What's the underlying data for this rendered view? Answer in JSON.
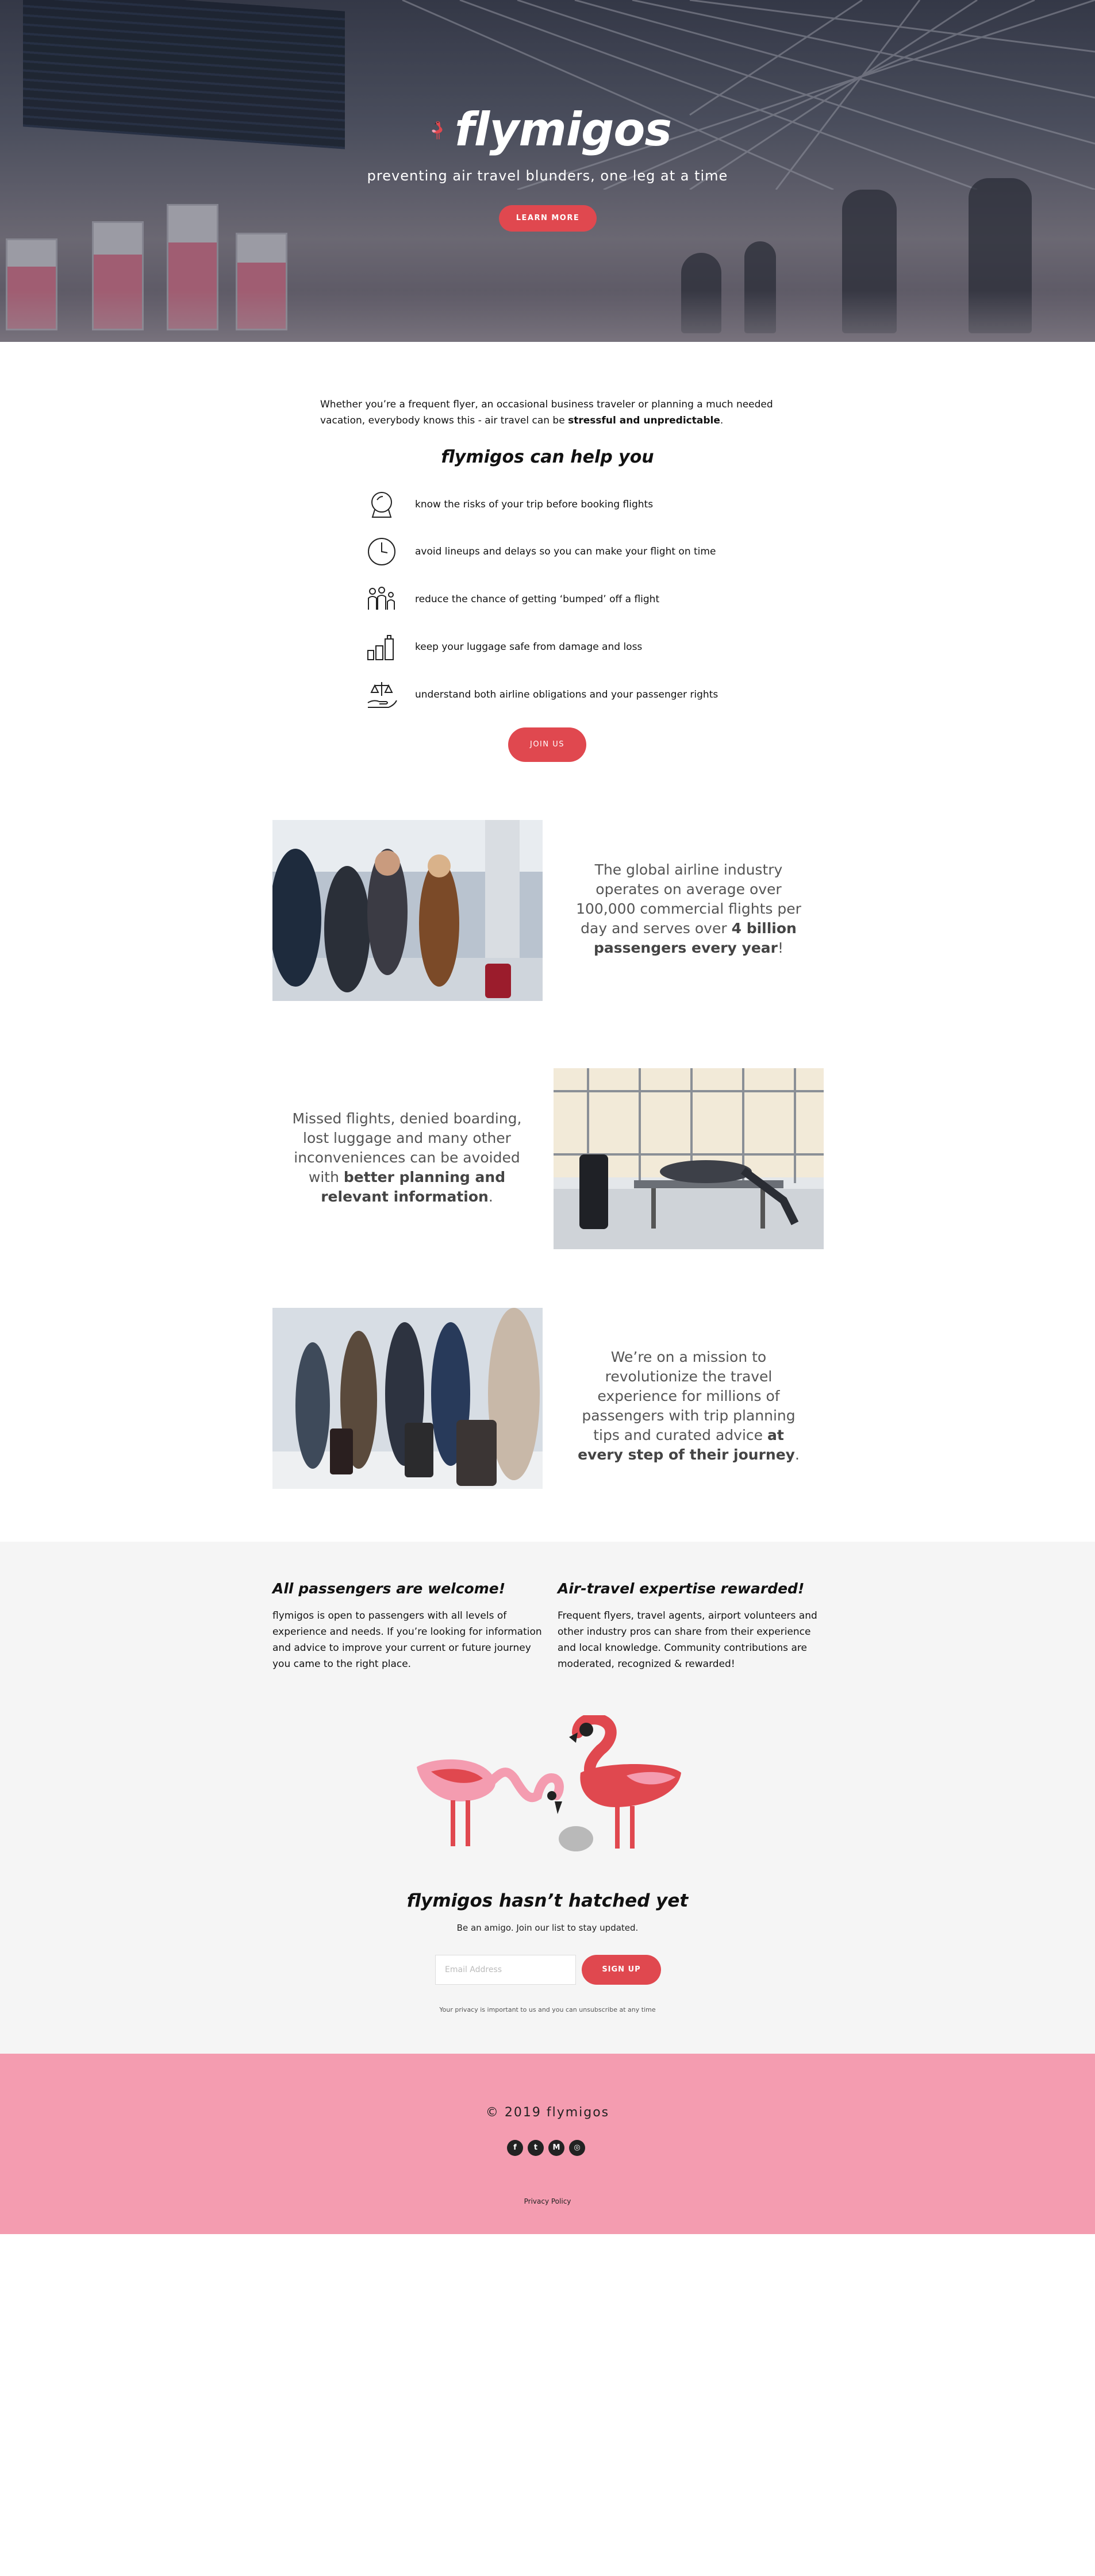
{
  "hero": {
    "brand": "flymigos",
    "tagline": "preventing air travel blunders, one leg at a time",
    "learn_more": "LEARN MORE"
  },
  "intro": {
    "text_before": "Whether you’re a frequent flyer, an occasional business traveler or planning a much needed vacation, everybody knows this - air travel can be ",
    "text_bold": "stressful and unpredictable",
    "text_after": "."
  },
  "help": {
    "title": "flymigos can help you",
    "items": [
      {
        "icon": "crystal-ball-icon",
        "text": "know the risks of your trip before booking flights"
      },
      {
        "icon": "clock-icon",
        "text": "avoid lineups and delays so you can make your flight on time"
      },
      {
        "icon": "people-icon",
        "text": "reduce the chance of getting ‘bumped’ off a flight"
      },
      {
        "icon": "luggage-icon",
        "text": "keep your luggage safe from damage and loss"
      },
      {
        "icon": "scales-hand-icon",
        "text": "understand both airline obligations and your passenger rights"
      }
    ],
    "join_label": "JOIN US"
  },
  "stories": [
    {
      "plain": "The global airline industry operates on average over 100,000 commercial flights per day and serves over ",
      "bold": "4 billion passengers every year",
      "end": "!"
    },
    {
      "plain": "Missed flights, denied boarding, lost luggage and many other inconveniences can be avoided with ",
      "bold": "better planning and relevant information",
      "end": "."
    },
    {
      "plain": "We’re on a mission to revolutionize the travel experience for millions of passengers with trip planning tips and curated advice ",
      "bold": "at every step of their journey",
      "end": "."
    }
  ],
  "columns": [
    {
      "title": "All passengers are welcome!",
      "text": "flymigos is open to passengers with all levels of experience and needs. If you’re looking for information and advice to improve your current or future journey you came to the right place."
    },
    {
      "title": "Air-travel expertise rewarded!",
      "text": "Frequent flyers, travel agents, airport volunteers and other industry pros can share from their experience and local knowledge. Community contributions are moderated, recognized & rewarded!"
    }
  ],
  "signup": {
    "title": "flymigos hasn’t hatched yet",
    "subtitle": "Be an amigo. Join our list to stay updated.",
    "email_placeholder": "Email Address",
    "button": "SIGN UP",
    "privacy": "Your privacy is important to us and you can unsubscribe at any time"
  },
  "footer": {
    "copyright": "© 2019 flymigos",
    "socials": [
      {
        "icon": "facebook-icon",
        "glyph": "f"
      },
      {
        "icon": "twitter-icon",
        "glyph": "t"
      },
      {
        "icon": "medium-icon",
        "glyph": "M"
      },
      {
        "icon": "instagram-icon",
        "glyph": "◎"
      }
    ],
    "policy": "Privacy Policy"
  },
  "colors": {
    "accent": "#e0484f",
    "footer_pink": "#f49cb0",
    "flamingo_light": "#f49cb0",
    "flamingo_dark": "#e0484f",
    "gray_bg": "#f5f5f5"
  }
}
